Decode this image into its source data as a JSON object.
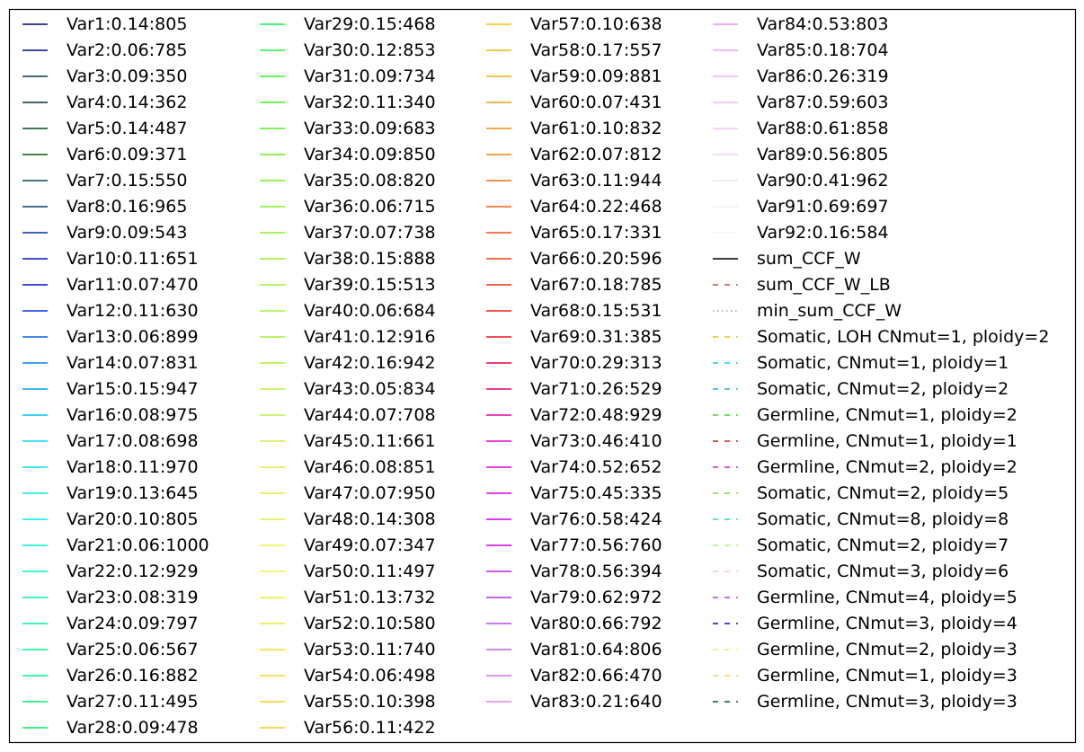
{
  "chart_data": {
    "type": "line",
    "title": "",
    "xlabel": "",
    "ylabel": "",
    "grid": false,
    "legend_placement": "full-figure",
    "legend": [
      {
        "entries": [
          {
            "label": "Var1:0.14:805",
            "color": "#000080",
            "style": "solid"
          },
          {
            "label": "Var2:0.06:785",
            "color": "#00107a",
            "style": "solid"
          },
          {
            "label": "Var3:0.09:350",
            "color": "#003a4a",
            "style": "solid"
          },
          {
            "label": "Var4:0.14:362",
            "color": "#00332f",
            "style": "solid"
          },
          {
            "label": "Var5:0.14:487",
            "color": "#004a20",
            "style": "solid"
          },
          {
            "label": "Var6:0.09:371",
            "color": "#005a10",
            "style": "solid"
          },
          {
            "label": "Var7:0.15:550",
            "color": "#004d4d",
            "style": "solid"
          },
          {
            "label": "Var8:0.16:965",
            "color": "#00406a",
            "style": "solid"
          },
          {
            "label": "Var9:0.09:543",
            "color": "#0030a0",
            "style": "solid"
          },
          {
            "label": "Var10:0.11:651",
            "color": "#0018b0",
            "style": "solid"
          },
          {
            "label": "Var11:0.07:470",
            "color": "#0010d0",
            "style": "solid"
          },
          {
            "label": "Var12:0.11:630",
            "color": "#0030e8",
            "style": "solid"
          },
          {
            "label": "Var13:0.06:899",
            "color": "#0060f0",
            "style": "solid"
          },
          {
            "label": "Var14:0.07:831",
            "color": "#0080f0",
            "style": "solid"
          },
          {
            "label": "Var15:0.15:947",
            "color": "#00a0f0",
            "style": "solid"
          },
          {
            "label": "Var16:0.08:975",
            "color": "#00c0f0",
            "style": "solid"
          },
          {
            "label": "Var17:0.08:698",
            "color": "#00d8f0",
            "style": "solid"
          },
          {
            "label": "Var18:0.11:970",
            "color": "#00e0f0",
            "style": "solid"
          },
          {
            "label": "Var19:0.13:645",
            "color": "#00e8e8",
            "style": "solid"
          },
          {
            "label": "Var20:0.10:805",
            "color": "#00eedc",
            "style": "solid"
          },
          {
            "label": "Var21:0.06:1000",
            "color": "#00f0d0",
            "style": "solid"
          },
          {
            "label": "Var22:0.12:929",
            "color": "#00f0c0",
            "style": "solid"
          },
          {
            "label": "Var23:0.08:319",
            "color": "#00f0b0",
            "style": "solid"
          },
          {
            "label": "Var24:0.09:797",
            "color": "#00f0a0",
            "style": "solid"
          },
          {
            "label": "Var25:0.06:567",
            "color": "#00f090",
            "style": "solid"
          },
          {
            "label": "Var26:0.16:882",
            "color": "#00f080",
            "style": "solid"
          },
          {
            "label": "Var27:0.11:495",
            "color": "#00f070",
            "style": "solid"
          },
          {
            "label": "Var28:0.09:478",
            "color": "#00f060",
            "style": "solid"
          }
        ]
      },
      {
        "entries": [
          {
            "label": "Var29:0.15:468",
            "color": "#10f050",
            "style": "solid"
          },
          {
            "label": "Var30:0.12:853",
            "color": "#20f040",
            "style": "solid"
          },
          {
            "label": "Var31:0.09:734",
            "color": "#30f030",
            "style": "solid"
          },
          {
            "label": "Var32:0.11:340",
            "color": "#40f020",
            "style": "solid"
          },
          {
            "label": "Var33:0.09:683",
            "color": "#50f020",
            "style": "solid"
          },
          {
            "label": "Var34:0.09:850",
            "color": "#60f020",
            "style": "solid"
          },
          {
            "label": "Var35:0.08:820",
            "color": "#70f020",
            "style": "solid"
          },
          {
            "label": "Var36:0.06:715",
            "color": "#80f020",
            "style": "solid"
          },
          {
            "label": "Var37:0.07:738",
            "color": "#88f020",
            "style": "solid"
          },
          {
            "label": "Var38:0.15:888",
            "color": "#90f028",
            "style": "solid"
          },
          {
            "label": "Var39:0.15:513",
            "color": "#98f030",
            "style": "solid"
          },
          {
            "label": "Var40:0.06:684",
            "color": "#a0f030",
            "style": "solid"
          },
          {
            "label": "Var41:0.12:916",
            "color": "#a8f030",
            "style": "solid"
          },
          {
            "label": "Var42:0.16:942",
            "color": "#b0f030",
            "style": "solid"
          },
          {
            "label": "Var43:0.05:834",
            "color": "#b8f040",
            "style": "solid"
          },
          {
            "label": "Var44:0.07:708",
            "color": "#c0f040",
            "style": "solid"
          },
          {
            "label": "Var45:0.11:661",
            "color": "#c8f040",
            "style": "solid"
          },
          {
            "label": "Var46:0.08:851",
            "color": "#d0f040",
            "style": "solid"
          },
          {
            "label": "Var47:0.07:950",
            "color": "#d8f040",
            "style": "solid"
          },
          {
            "label": "Var48:0.14:308",
            "color": "#e0f040",
            "style": "solid"
          },
          {
            "label": "Var49:0.07:347",
            "color": "#e8f040",
            "style": "solid"
          },
          {
            "label": "Var50:0.11:497",
            "color": "#f0f040",
            "style": "solid"
          },
          {
            "label": "Var51:0.13:732",
            "color": "#f0ec30",
            "style": "solid"
          },
          {
            "label": "Var52:0.10:580",
            "color": "#f0e830",
            "style": "solid"
          },
          {
            "label": "Var53:0.11:740",
            "color": "#f0e020",
            "style": "solid"
          },
          {
            "label": "Var54:0.06:498",
            "color": "#f0d820",
            "style": "solid"
          },
          {
            "label": "Var55:0.10:398",
            "color": "#f0d020",
            "style": "solid"
          },
          {
            "label": "Var56:0.11:422",
            "color": "#f0c820",
            "style": "solid"
          }
        ]
      },
      {
        "entries": [
          {
            "label": "Var57:0.10:638",
            "color": "#f0c010",
            "style": "solid"
          },
          {
            "label": "Var58:0.17:557",
            "color": "#f0b810",
            "style": "solid"
          },
          {
            "label": "Var59:0.09:881",
            "color": "#f0b010",
            "style": "solid"
          },
          {
            "label": "Var60:0.07:431",
            "color": "#f0a010",
            "style": "solid"
          },
          {
            "label": "Var61:0.10:832",
            "color": "#f09010",
            "style": "solid"
          },
          {
            "label": "Var62:0.07:812",
            "color": "#f08010",
            "style": "solid"
          },
          {
            "label": "Var63:0.11:944",
            "color": "#f07010",
            "style": "solid"
          },
          {
            "label": "Var64:0.22:468",
            "color": "#f06010",
            "style": "solid"
          },
          {
            "label": "Var65:0.17:331",
            "color": "#f05010",
            "style": "solid"
          },
          {
            "label": "Var66:0.20:596",
            "color": "#f04010",
            "style": "solid"
          },
          {
            "label": "Var67:0.18:785",
            "color": "#f03010",
            "style": "solid"
          },
          {
            "label": "Var68:0.15:531",
            "color": "#f02010",
            "style": "solid"
          },
          {
            "label": "Var69:0.31:385",
            "color": "#f01020",
            "style": "solid"
          },
          {
            "label": "Var70:0.29:313",
            "color": "#e80040",
            "style": "solid"
          },
          {
            "label": "Var71:0.26:529",
            "color": "#e80070",
            "style": "solid"
          },
          {
            "label": "Var72:0.48:929",
            "color": "#e800a0",
            "style": "solid"
          },
          {
            "label": "Var73:0.46:410",
            "color": "#e800c8",
            "style": "solid"
          },
          {
            "label": "Var74:0.52:652",
            "color": "#e000d8",
            "style": "solid"
          },
          {
            "label": "Var75:0.45:335",
            "color": "#d800e0",
            "style": "solid"
          },
          {
            "label": "Var76:0.58:424",
            "color": "#d000e8",
            "style": "solid"
          },
          {
            "label": "Var77:0.56:760",
            "color": "#c800e8",
            "style": "solid"
          },
          {
            "label": "Var78:0.56:394",
            "color": "#b820e8",
            "style": "solid"
          },
          {
            "label": "Var79:0.62:972",
            "color": "#b030e8",
            "style": "solid"
          },
          {
            "label": "Var80:0.66:792",
            "color": "#b848e8",
            "style": "solid"
          },
          {
            "label": "Var81:0.64:806",
            "color": "#c060e8",
            "style": "solid"
          },
          {
            "label": "Var82:0.66:470",
            "color": "#d070e8",
            "style": "solid"
          },
          {
            "label": "Var83:0.21:640",
            "color": "#e080f0",
            "style": "solid"
          }
        ]
      },
      {
        "entries": [
          {
            "label": "Var84:0.53:803",
            "color": "#e890f0",
            "style": "solid"
          },
          {
            "label": "Var85:0.18:704",
            "color": "#f0a0f0",
            "style": "solid"
          },
          {
            "label": "Var86:0.26:319",
            "color": "#f0b0f0",
            "style": "solid"
          },
          {
            "label": "Var87:0.59:603",
            "color": "#f0b8f0",
            "style": "solid"
          },
          {
            "label": "Var88:0.61:858",
            "color": "#f0c0f0",
            "style": "solid"
          },
          {
            "label": "Var89:0.56:805",
            "color": "#f0d0f0",
            "style": "solid"
          },
          {
            "label": "Var90:0.41:962",
            "color": "#f0e0f0",
            "style": "solid"
          },
          {
            "label": "Var91:0.69:697",
            "color": "#f0f0f0",
            "style": "solid"
          },
          {
            "label": "Var92:0.16:584",
            "color": "#faf4fa",
            "style": "solid"
          },
          {
            "label": "sum_CCF_W",
            "color": "#000000",
            "style": "solid"
          },
          {
            "label": "sum_CCF_W_LB",
            "color": "#c0504d",
            "style": "dashed"
          },
          {
            "label": "min_sum_CCF_W",
            "color": "#999999",
            "style": "dotted"
          },
          {
            "label": "Somatic, LOH CNmut=1, ploidy=2",
            "color": "#f0c000",
            "style": "dashed"
          },
          {
            "label": "Somatic, CNmut=1, ploidy=1",
            "color": "#00d8d8",
            "style": "dashed"
          },
          {
            "label": "Somatic, CNmut=2, ploidy=2",
            "color": "#20b0d8",
            "style": "dashed"
          },
          {
            "label": "Germline, CNmut=1, ploidy=2",
            "color": "#40d020",
            "style": "dashed"
          },
          {
            "label": "Germline, CNmut=1, ploidy=1",
            "color": "#e02020",
            "style": "dashed"
          },
          {
            "label": "Germline, CNmut=2, ploidy=2",
            "color": "#e020c0",
            "style": "dashed"
          },
          {
            "label": "Somatic, CNmut=2, ploidy=5",
            "color": "#80d040",
            "style": "dashed"
          },
          {
            "label": "Somatic, CNmut=8, ploidy=8",
            "color": "#20e0c0",
            "style": "dashed"
          },
          {
            "label": "Somatic, CNmut=2, ploidy=7",
            "color": "#b0f070",
            "style": "dashed"
          },
          {
            "label": "Somatic, CNmut=3, ploidy=6",
            "color": "#f8c0f0",
            "style": "dashed"
          },
          {
            "label": "Germline, CNmut=4, ploidy=5",
            "color": "#b040e0",
            "style": "dashed"
          },
          {
            "label": "Germline, CNmut=3, ploidy=4",
            "color": "#0010d0",
            "style": "dashed"
          },
          {
            "label": "Germline, CNmut=2, ploidy=3",
            "color": "#e8f060",
            "style": "dashed"
          },
          {
            "label": "Germline, CNmut=1, ploidy=3",
            "color": "#f0d040",
            "style": "dashed"
          },
          {
            "label": "Germline, CNmut=3, ploidy=3",
            "color": "#005a20",
            "style": "dashed"
          }
        ]
      }
    ]
  }
}
